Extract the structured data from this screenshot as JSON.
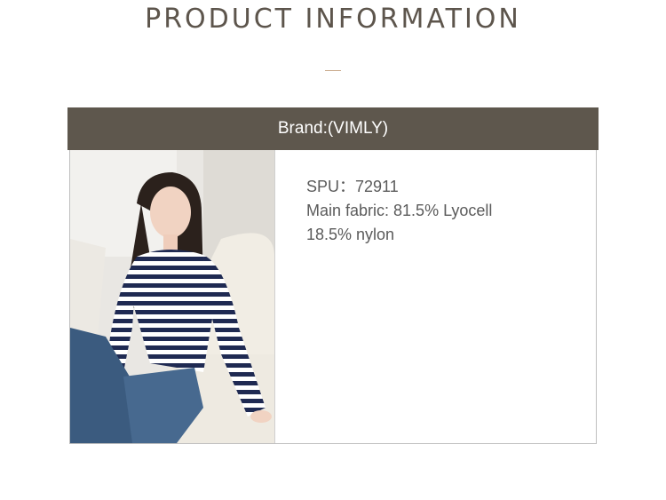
{
  "header": {
    "title": "PRODUCT INFORMATION"
  },
  "brand": {
    "label": "Brand:(VIMLY)"
  },
  "product": {
    "spu": "SPU：72911",
    "fabric_line1": "Main fabric: 81.5% Lyocell",
    "fabric_line2": "18.5% nylon"
  },
  "colors": {
    "bar": "#5e574d",
    "divider": "#c9a98a",
    "title": "#5d554c"
  }
}
